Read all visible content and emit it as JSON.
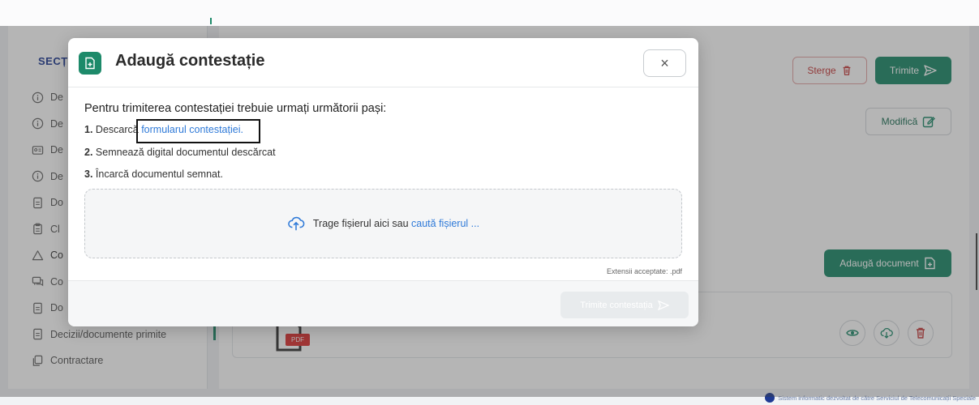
{
  "sidebar": {
    "section_title": "SECȚI",
    "items": [
      {
        "label": "De",
        "icon": "info-icon"
      },
      {
        "label": "De",
        "icon": "info-icon"
      },
      {
        "label": "De",
        "icon": "id-card-icon"
      },
      {
        "label": "De",
        "icon": "info-icon"
      },
      {
        "label": "Do",
        "icon": "document-icon"
      },
      {
        "label": "Cl",
        "icon": "clipboard-icon"
      },
      {
        "label": "Co",
        "icon": "warning-icon"
      },
      {
        "label": "Co",
        "icon": "chat-icon"
      },
      {
        "label": "Do",
        "icon": "document-icon"
      },
      {
        "label": "Decizii/documente primite",
        "icon": "document-icon"
      },
      {
        "label": "Contractare",
        "icon": "copy-icon"
      }
    ]
  },
  "toolbar": {
    "sterge_label": "Sterge",
    "trimite_label": "Trimite",
    "modifica_label": "Modifică",
    "adauga_document_label": "Adaugă document"
  },
  "document_card": {
    "pdf_tag": "PDF"
  },
  "footer": {
    "note": "Sistem informatic dezvoltat de către Serviciul de Telecomunicații Speciale"
  },
  "modal": {
    "title": "Adaugă contestație",
    "close_symbol": "×",
    "instructions_heading": "Pentru trimiterea contestației trebuie urmați următorii pași:",
    "steps": [
      {
        "number": "1.",
        "text": "Descarcă ",
        "link": "formularul contestației."
      },
      {
        "number": "2.",
        "text": "Semnează digital documentul descărcat"
      },
      {
        "number": "3.",
        "text": "Încarcă documentul semnat."
      }
    ],
    "dropzone": {
      "text": "Trage fișierul aici",
      "connector": "sau",
      "link": "caută fișierul ..."
    },
    "accepted_extensions": "Extensii acceptate: .pdf",
    "submit_label": "Trimite contestația"
  },
  "colors": {
    "primary_green": "#1d8a6a",
    "danger_red": "#c63a3a",
    "link_blue": "#2f7ad8",
    "section_blue": "#1f3a93"
  }
}
